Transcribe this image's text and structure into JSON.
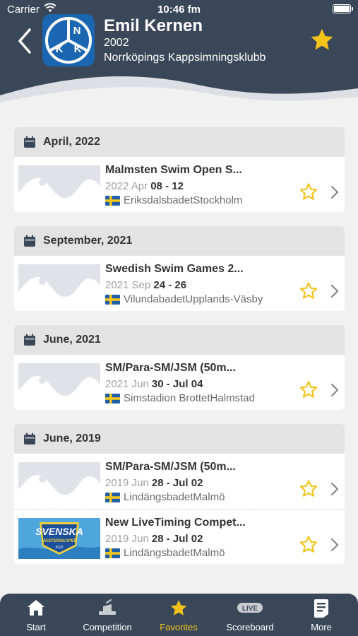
{
  "status_bar": {
    "carrier": "Carrier",
    "time": "10:46 fm"
  },
  "header": {
    "logo_letters": [
      "N",
      "K",
      "K"
    ],
    "name": "Emil Kernen",
    "year": "2002",
    "club": "Norrköpings Kappsimningsklubb"
  },
  "groups": [
    {
      "month": "April, 2022",
      "events": [
        {
          "title": "Malmsten Swim Open S...",
          "date_prefix": "2022 Apr ",
          "date_range": "08 - 12",
          "venue": "EriksdalsbadetStockholm",
          "thumb": "placeholder"
        }
      ]
    },
    {
      "month": "September, 2021",
      "events": [
        {
          "title": "Swedish Swim Games 2...",
          "date_prefix": "2021 Sep ",
          "date_range": "24 - 26",
          "venue": "VilundabadetUpplands-Väsby",
          "thumb": "placeholder"
        }
      ]
    },
    {
      "month": "June, 2021",
      "events": [
        {
          "title": "SM/Para-SM/JSM (50m...",
          "date_prefix": "2021 Jun ",
          "date_range": "30 - Jul 04",
          "venue": "Simstadion BrottetHalmstad",
          "thumb": "placeholder"
        }
      ]
    },
    {
      "month": "June, 2019",
      "events": [
        {
          "title": "SM/Para-SM/JSM (50m...",
          "date_prefix": "2019 Jun ",
          "date_range": "28 - Jul 02",
          "venue": "LindängsbadetMalmö",
          "thumb": "placeholder"
        },
        {
          "title": "New LiveTiming Compet...",
          "date_prefix": "2019 Jun ",
          "date_range": "28 - Jul 02",
          "venue": "LindängsbadetMalmö",
          "thumb": "svenska-masterskapen-logo"
        }
      ]
    }
  ],
  "thumb_logo": {
    "line1": "SVENSKA",
    "line2": "MÄSTERSKAPEN",
    "line3": "2022"
  },
  "tabs": [
    {
      "label": "Start",
      "icon": "home-icon",
      "active": false
    },
    {
      "label": "Competition",
      "icon": "starting-block-icon",
      "active": false
    },
    {
      "label": "Favorites",
      "icon": "star-icon",
      "active": true
    },
    {
      "label": "Scoreboard",
      "icon": "live-icon",
      "badge": "LIVE",
      "active": false
    },
    {
      "label": "More",
      "icon": "document-list-icon",
      "active": false
    }
  ],
  "colors": {
    "header_bg": "#3a4759",
    "accent_star": "#f4c31a",
    "page_bg": "#f1f1f1",
    "month_header_bg": "#e3e3e3"
  }
}
